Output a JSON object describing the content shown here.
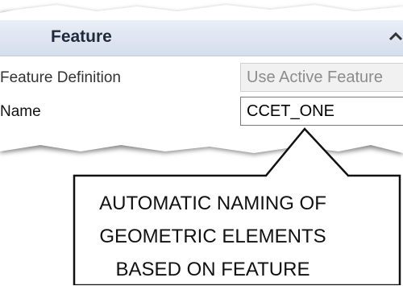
{
  "panel": {
    "section_title": "Feature",
    "collapse_icon": "chevron-up-icon",
    "rows": [
      {
        "label": "Feature Definition",
        "value": "Use Active Feature",
        "state": "disabled"
      },
      {
        "label": "Name",
        "value": "CCET_ONE",
        "state": "active"
      }
    ]
  },
  "callout": {
    "lines": [
      "AUTOMATIC NAMING OF",
      "GEOMETRIC ELEMENTS",
      "BASED ON FEATURE"
    ]
  },
  "colors": {
    "header_bg": "#d6deec",
    "header_text": "#1f2a3c",
    "disabled_text": "#8c8c8c",
    "callout_border": "#111111"
  }
}
